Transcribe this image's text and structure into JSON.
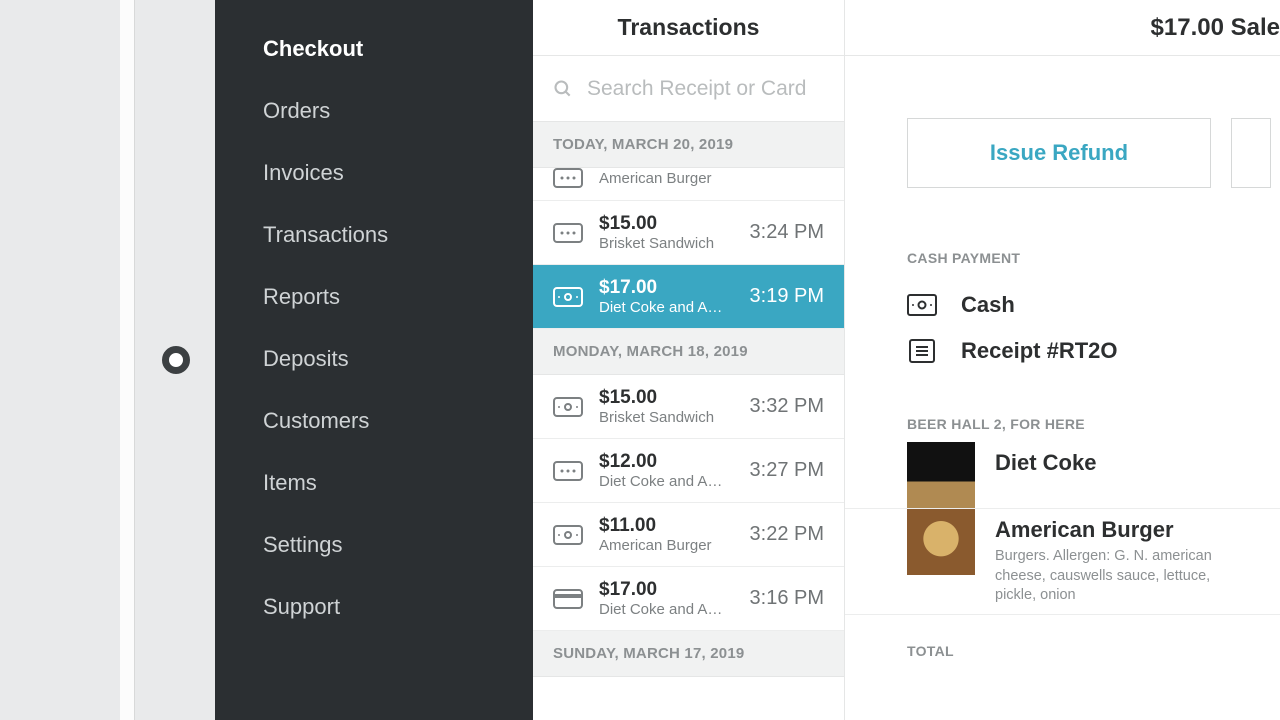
{
  "sidebar": {
    "items": [
      {
        "label": "Checkout",
        "active": true
      },
      {
        "label": "Orders"
      },
      {
        "label": "Invoices"
      },
      {
        "label": "Transactions"
      },
      {
        "label": "Reports"
      },
      {
        "label": "Deposits"
      },
      {
        "label": "Customers"
      },
      {
        "label": "Items"
      },
      {
        "label": "Settings"
      },
      {
        "label": "Support"
      }
    ]
  },
  "mid": {
    "title": "Transactions",
    "search_placeholder": "Search Receipt or Card",
    "groups": [
      {
        "date": "TODAY, MARCH 20, 2019",
        "txns": [
          {
            "amount": "",
            "desc": "American Burger",
            "time": "",
            "icon": "card",
            "partial": true
          },
          {
            "amount": "$15.00",
            "desc": "Brisket Sandwich",
            "time": "3:24 PM",
            "icon": "card"
          },
          {
            "amount": "$17.00",
            "desc": "Diet Coke and Ameri…",
            "time": "3:19 PM",
            "icon": "cash",
            "selected": true
          }
        ]
      },
      {
        "date": "MONDAY, MARCH 18, 2019",
        "txns": [
          {
            "amount": "$15.00",
            "desc": "Brisket Sandwich",
            "time": "3:32 PM",
            "icon": "cash"
          },
          {
            "amount": "$12.00",
            "desc": "Diet Coke and Ameri…",
            "time": "3:27 PM",
            "icon": "card"
          },
          {
            "amount": "$11.00",
            "desc": "American Burger",
            "time": "3:22 PM",
            "icon": "cash"
          },
          {
            "amount": "$17.00",
            "desc": "Diet Coke and Ameri…",
            "time": "3:16 PM",
            "icon": "credit"
          }
        ]
      },
      {
        "date": "SUNDAY, MARCH 17, 2019",
        "txns": []
      }
    ]
  },
  "detail": {
    "title": "$17.00 Sale",
    "refund_label": "Issue Refund",
    "section_payment": "CASH PAYMENT",
    "payment_method": "Cash",
    "receipt": "Receipt #RT2O",
    "location": "BEER HALL 2, FOR HERE",
    "items": [
      {
        "name": "Diet Coke",
        "sub": "",
        "thumb": "dark"
      },
      {
        "name": "American Burger",
        "sub": "Burgers. Allergen: G. N. american cheese, causwells sauce, lettuce, pickle, onion",
        "thumb": "burger"
      }
    ],
    "total_label": "TOTAL"
  }
}
